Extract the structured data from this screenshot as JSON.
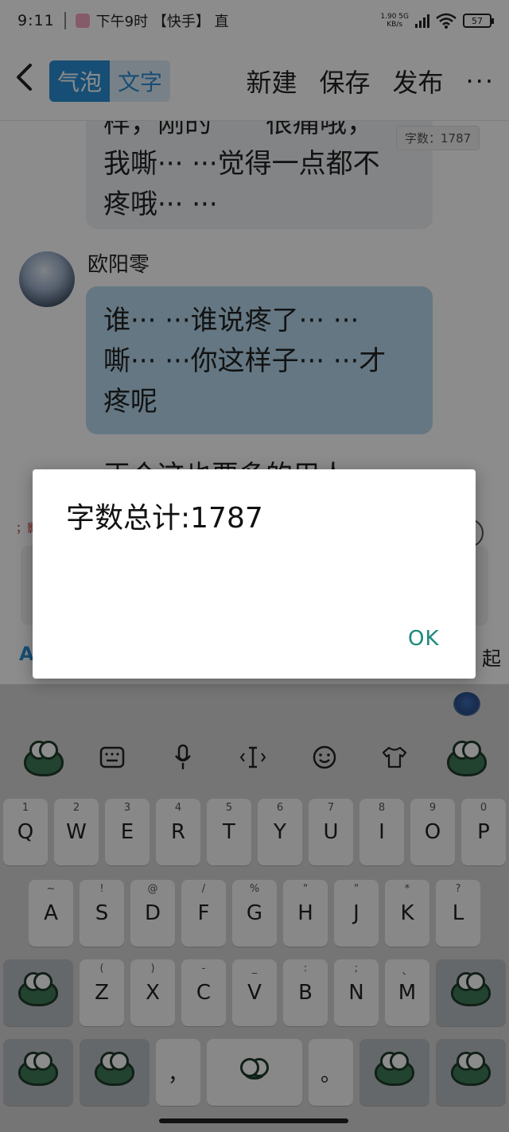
{
  "status_bar": {
    "time": "9:11",
    "notification": "下午9时 【快手】 直",
    "net_speed": "1.90 5G\nKB/s",
    "battery": "57"
  },
  "header": {
    "back_icon": "chevron-left-icon",
    "tab_bubble": "气泡",
    "tab_text": "文字",
    "new_label": "新建",
    "save_label": "保存",
    "publish_label": "发布",
    "more_label": "···"
  },
  "chat": {
    "word_count_tag": "字数：1787",
    "grey_bubble_text": "样，刚的　　很痛哦，\n我嘶··· ···觉得一点都不\n疼哦··· ···",
    "sender_name": "欧阳零",
    "blue_bubble_text": "谁··· ···谁说疼了··· ···\n嘶··· ···你这样子··· ···才\n疼呢",
    "partial_text": "正个这也要多的用人",
    "toolbar_fragment": "；影",
    "a_button": "A",
    "collapse_label": "起"
  },
  "dialog": {
    "message": "字数总计:1787",
    "ok_label": "OK"
  },
  "keyboard": {
    "toolbar_icons": [
      "frog-icon",
      "keyboard-icon",
      "microphone-icon",
      "cursor-icon",
      "emoji-icon",
      "tshirt-icon",
      "frog-icon"
    ],
    "row1": [
      {
        "key": "Q",
        "hint": "1"
      },
      {
        "key": "W",
        "hint": "2"
      },
      {
        "key": "E",
        "hint": "3"
      },
      {
        "key": "R",
        "hint": "4"
      },
      {
        "key": "T",
        "hint": "5"
      },
      {
        "key": "Y",
        "hint": "6"
      },
      {
        "key": "U",
        "hint": "7"
      },
      {
        "key": "I",
        "hint": "8"
      },
      {
        "key": "O",
        "hint": "9"
      },
      {
        "key": "P",
        "hint": "0"
      }
    ],
    "row2": [
      {
        "key": "A",
        "hint": "~"
      },
      {
        "key": "S",
        "hint": "!"
      },
      {
        "key": "D",
        "hint": "@"
      },
      {
        "key": "F",
        "hint": "/"
      },
      {
        "key": "G",
        "hint": "%"
      },
      {
        "key": "H",
        "hint": "\""
      },
      {
        "key": "J",
        "hint": "\""
      },
      {
        "key": "K",
        "hint": "*"
      },
      {
        "key": "L",
        "hint": "?"
      }
    ],
    "row3": [
      {
        "key": "Z",
        "hint": "("
      },
      {
        "key": "X",
        "hint": ")"
      },
      {
        "key": "C",
        "hint": "-"
      },
      {
        "key": "V",
        "hint": "_"
      },
      {
        "key": "B",
        "hint": ":"
      },
      {
        "key": "N",
        "hint": ";"
      },
      {
        "key": "M",
        "hint": "、"
      }
    ],
    "comma": "，",
    "period": "。"
  }
}
